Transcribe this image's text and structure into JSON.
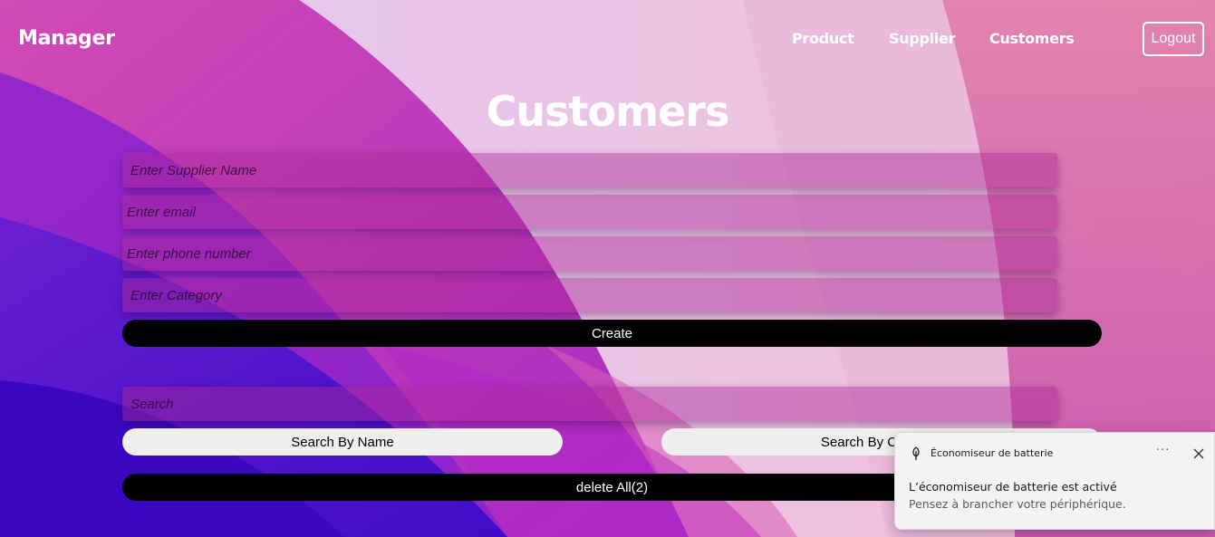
{
  "app": {
    "brand": "Manager",
    "nav": {
      "product": "Product",
      "supplier": "Supplier",
      "customers": "Customers"
    },
    "logout_label": "Logout"
  },
  "page": {
    "title": "Customers"
  },
  "form": {
    "name_placeholder": "Enter Supplier Name",
    "email_placeholder": "Enter email",
    "phone_placeholder": "Enter phone number",
    "category_placeholder": "Enter Category",
    "create_label": "Create"
  },
  "search": {
    "placeholder": "Search",
    "by_name_label": "Search By Name",
    "by_category_label": "Search By Category"
  },
  "delete_all_label": "delete All(2)",
  "notification": {
    "app_name": "Économiseur de batterie",
    "icon": "leaf-icon",
    "more_label": "···",
    "heading": "L’économiseur de batterie est activé",
    "body": "Pensez à brancher votre périphérique."
  },
  "colors": {
    "button_dark": "#000000",
    "button_light": "#efefef",
    "text_light": "#ffffff",
    "toast_bg": "#f3f3f3"
  }
}
